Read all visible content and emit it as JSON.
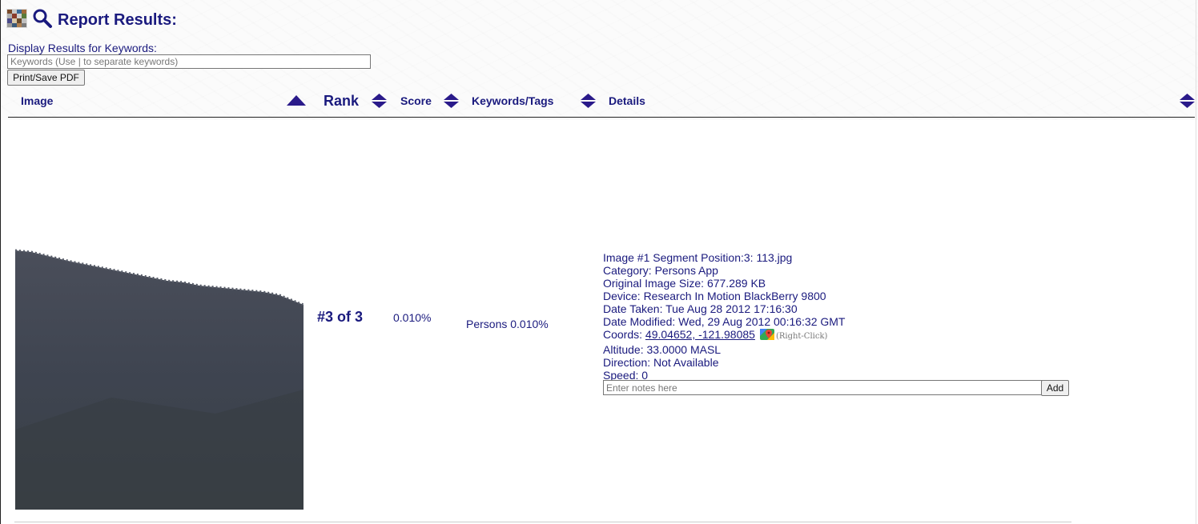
{
  "header": {
    "title": "Report Results:"
  },
  "filter": {
    "label": "Display Results for Keywords:",
    "placeholder": "Keywords (Use | to separate keywords)",
    "print_button": "Print/Save PDF"
  },
  "columns": {
    "image": "Image",
    "rank": "Rank",
    "score": "Score",
    "keywords": "Keywords/Tags",
    "details": "Details"
  },
  "result": {
    "rank": "#3 of 3",
    "score": "0.010%",
    "keywords": "Persons 0.010%",
    "details": {
      "image_line": "Image #1 Segment Position:3: 113.jpg",
      "category": "Category: Persons App",
      "original_size": "Original Image Size: 677.289 KB",
      "device": "Device: Research In Motion BlackBerry 9800",
      "date_taken": "Date Taken: Tue Aug 28 2012 17:16:30",
      "date_modified": "Date Modified: Wed, 29 Aug 2012 00:16:32 GMT",
      "coords_label": "Coords: ",
      "coords_value": "49.04652, -121.98085",
      "right_click_note": "(Right-Click)",
      "altitude": "Altitude: 33.0000 MASL",
      "direction": "Direction: Not Available",
      "speed": "Speed: 0"
    },
    "notes_placeholder": "Enter notes here",
    "add_button": "Add"
  },
  "icons": {
    "app": "photo-mosaic-icon",
    "search": "magnifier-icon",
    "sort_asc": "sort-ascending-triangle-icon",
    "sort_both": "sort-both-diamond-icon",
    "maps": "google-maps-icon"
  },
  "colors": {
    "accent": "#1a1a7e",
    "sort_icon": "#2a1a8a"
  }
}
